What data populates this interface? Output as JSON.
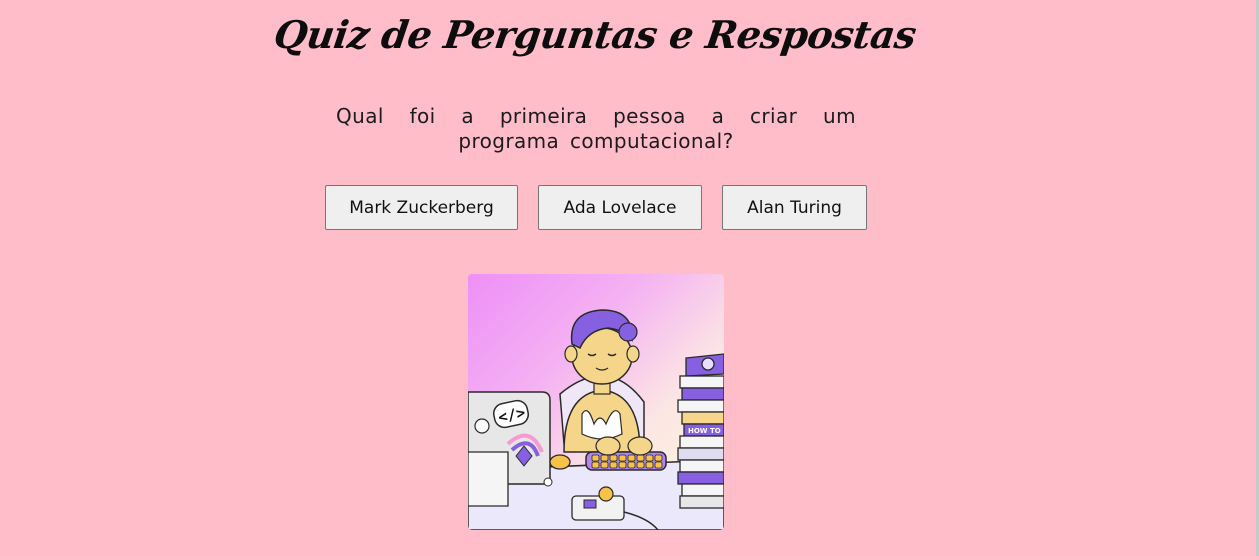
{
  "page": {
    "title": "Quiz de Perguntas e Respostas"
  },
  "quiz": {
    "question": "Qual foi a primeira pessoa a criar um programa computacional?",
    "answers": [
      {
        "label": "Mark Zuckerberg"
      },
      {
        "label": "Ada Lovelace"
      },
      {
        "label": "Alan Turing"
      }
    ]
  },
  "illustration": {
    "book_spine_text": "HOW TO",
    "laptop_sticker_text": "</>"
  },
  "colors": {
    "background": "#ffbcc9",
    "button_bg": "#efefef",
    "button_border": "#767676",
    "hair": "#8660e0",
    "accent_yellow": "#f7c24a"
  }
}
